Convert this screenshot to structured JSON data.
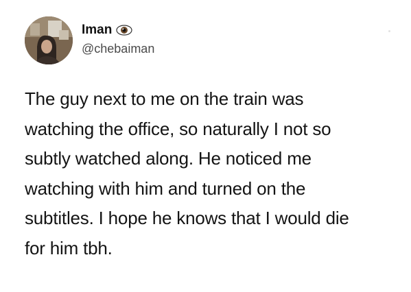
{
  "tweet": {
    "display_name": "Iman",
    "name_badge_icon": "eye-icon",
    "handle": "@chebaiman",
    "text": "The guy next to me on the train was\nwatching the office, so naturally I not so\nsubtly watched along. He noticed me\nwatching with him and turned on the\nsubtitles. I hope he knows that I would die\nfor him tbh."
  },
  "colors": {
    "text": "#141414",
    "handle": "#4a4a4a",
    "background": "#ffffff"
  }
}
